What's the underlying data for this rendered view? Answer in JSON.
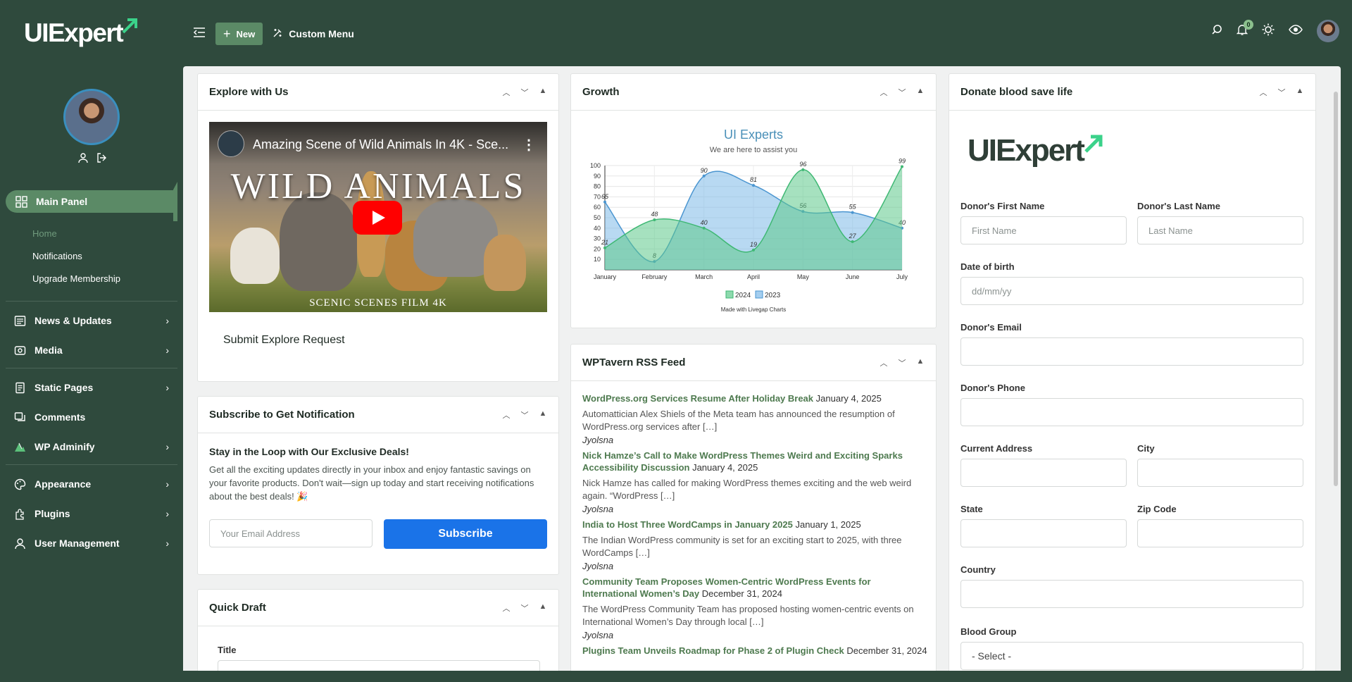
{
  "brand": {
    "logo_text": "UIExpert"
  },
  "sidebar": {
    "main_panel": "Main Panel",
    "subitems": [
      "Home",
      "Notifications",
      "Upgrade Membership"
    ],
    "items": [
      {
        "label": "News & Updates",
        "icon": "news-icon",
        "has_children": true
      },
      {
        "label": "Media",
        "icon": "media-icon",
        "has_children": true
      },
      {
        "label": "Static Pages",
        "icon": "pages-icon",
        "has_children": true
      },
      {
        "label": "Comments",
        "icon": "comments-icon",
        "has_children": false
      },
      {
        "label": "WP Adminify",
        "icon": "adminify-icon",
        "has_children": true
      },
      {
        "label": "Appearance",
        "icon": "appearance-icon",
        "has_children": true
      },
      {
        "label": "Plugins",
        "icon": "plugins-icon",
        "has_children": true
      },
      {
        "label": "User Management",
        "icon": "users-icon",
        "has_children": true
      }
    ]
  },
  "topbar": {
    "new_label": "New",
    "custom_menu_label": "Custom Menu",
    "notification_count": "0"
  },
  "explore": {
    "title": "Explore with Us",
    "video_title": "Amazing Scene of Wild Animals In 4K - Sce...",
    "video_banner": "WILD ANIMALS",
    "video_footer": "SCENIC SCENES FILM 4K",
    "link": "Submit Explore Request"
  },
  "subscribe": {
    "title": "Subscribe to Get Notification",
    "heading": "Stay in the Loop with Our Exclusive Deals!",
    "body": "Get all the exciting updates directly in your inbox and enjoy fantastic savings on your favorite products. Don't wait—sign up today and start receiving notifications about the best deals! 🎉",
    "email_placeholder": "Your Email Address",
    "button": "Subscribe"
  },
  "quick_draft": {
    "title": "Quick Draft",
    "title_label": "Title"
  },
  "growth": {
    "title": "Growth",
    "footer": "Made with Livegap Charts"
  },
  "chart_data": {
    "type": "area",
    "title": "UI Experts",
    "subtitle": "We are here to assist you",
    "categories": [
      "January",
      "February",
      "March",
      "April",
      "May",
      "June",
      "July"
    ],
    "ylim": [
      0,
      100
    ],
    "yticks": [
      10,
      20,
      30,
      40,
      50,
      60,
      70,
      80,
      90,
      100
    ],
    "grid": true,
    "legend": "bottom",
    "series": [
      {
        "name": "2024",
        "values": [
          21,
          48,
          40,
          19,
          96,
          27,
          99
        ],
        "color": "#5cc98a"
      },
      {
        "name": "2023",
        "values": [
          65,
          8,
          90,
          81,
          56,
          55,
          40
        ],
        "color": "#7db9e8"
      }
    ]
  },
  "rss": {
    "title": "WPTavern RSS Feed",
    "items": [
      {
        "title": "WordPress.org Services Resume After Holiday Break",
        "date": "January 4, 2025",
        "desc": "Automattician Alex Shiels of the Meta team has announced the resumption of WordPress.org services after […]",
        "author": "Jyolsna"
      },
      {
        "title": "Nick Hamze’s Call to Make WordPress Themes Weird and Exciting Sparks Accessibility Discussion",
        "date": "January 4, 2025",
        "desc": "Nick Hamze has called for making WordPress themes exciting and the web weird again. “WordPress […]",
        "author": "Jyolsna"
      },
      {
        "title": "India to Host Three WordCamps in January 2025",
        "date": "January 1, 2025",
        "desc": "The Indian WordPress community is set for an exciting start to 2025, with three WordCamps […]",
        "author": "Jyolsna"
      },
      {
        "title": "Community Team Proposes Women-Centric WordPress Events for International Women’s Day",
        "date": "December 31, 2024",
        "desc": "The WordPress Community Team has proposed hosting women-centric events on International Women’s Day through local […]",
        "author": "Jyolsna"
      },
      {
        "title": "Plugins Team Unveils Roadmap for Phase 2 of Plugin Check",
        "date": "December 31, 2024",
        "desc": "",
        "author": ""
      }
    ]
  },
  "donate": {
    "title": "Donate blood save life",
    "logo_text": "UIExpert",
    "first_name_label": "Donor's First Name",
    "first_name_placeholder": "First Name",
    "last_name_label": "Donor's Last Name",
    "last_name_placeholder": "Last Name",
    "dob_label": "Date of birth",
    "dob_placeholder": "dd/mm/yy",
    "email_label": "Donor's Email",
    "phone_label": "Donor's Phone",
    "address_label": "Current Address",
    "city_label": "City",
    "state_label": "State",
    "zip_label": "Zip Code",
    "country_label": "Country",
    "blood_label": "Blood Group",
    "blood_value": "- Select -"
  }
}
